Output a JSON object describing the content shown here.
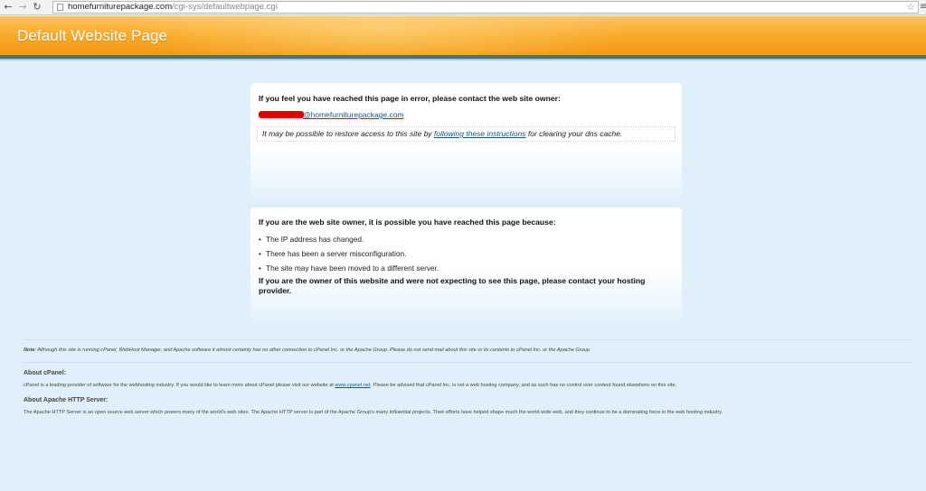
{
  "browser": {
    "url_host": "homefurniturepackage.com",
    "url_path": "/cgi-sys/defaultwebpage.cgi"
  },
  "header": {
    "title": "Default Website Page"
  },
  "box1": {
    "heading": "If you feel you have reached this page in error, please contact the web site owner:",
    "email_visible": "@homefurniturepackage.com",
    "notice_before": "It may be possible to restore access to this site by ",
    "notice_link": "following these instructions",
    "notice_after": " for clearing your dns cache."
  },
  "box2": {
    "heading": "If you are the web site owner, it is possible you have reached this page because:",
    "reasons": [
      "The IP address has changed.",
      "There has been a server misconfiguration.",
      "The site may have been moved to a different server."
    ],
    "contact": "If you are the owner of this website and were not expecting to see this page, please contact your hosting provider."
  },
  "footer": {
    "note_label": "Note",
    "note_text": ": Although this site is running cPanel, WebHost Manager, and Apache software it almost certainly has no other connection to cPanel Inc. or the Apache Group. Please do not send mail about this site or its contents to cPanel Inc. or the Apache Group.",
    "cpanel_heading": "About cPanel:",
    "cpanel_before": "cPanel is a leading provider of software for the webhosting industry. If you would like to learn more about cPanel please visit our website at ",
    "cpanel_link": "www.cpanel.net",
    "cpanel_after": ". Please be advised that cPanel Inc. is not a web hosting company, and as such has no control over content found elsewhere on this site.",
    "apache_heading": "About Apache HTTP Server:",
    "apache_text": "The Apache HTTP Server is an open source web server which powers many of the world's web sites. The Apache HTTP server is part of the Apache Group's many influential projects. Their efforts have helped shape much the world wide web, and they continue to be a dominating force in the web hosting industry."
  },
  "colors": {
    "header_orange": "#f7a825",
    "page_bg": "#dff0fb",
    "link": "#15598a",
    "redaction": "#e00000"
  },
  "icons": [
    "back-icon",
    "forward-icon",
    "reload-icon",
    "page-icon",
    "star-icon",
    "menu-icon"
  ]
}
